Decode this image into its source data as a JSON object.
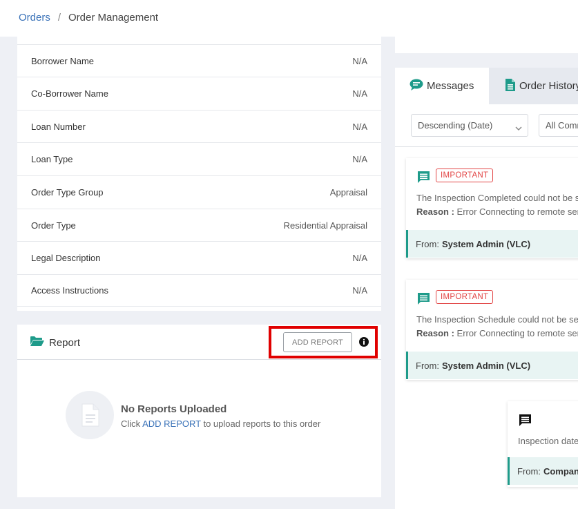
{
  "breadcrumb": {
    "root": "Orders",
    "separator": "/",
    "current": "Order Management"
  },
  "details": [
    {
      "label": "Borrower Name",
      "value": "N/A"
    },
    {
      "label": "Co-Borrower Name",
      "value": "N/A"
    },
    {
      "label": "Loan Number",
      "value": "N/A"
    },
    {
      "label": "Loan Type",
      "value": "N/A"
    },
    {
      "label": "Order Type Group",
      "value": "Appraisal"
    },
    {
      "label": "Order Type",
      "value": "Residential Appraisal"
    },
    {
      "label": "Legal Description",
      "value": "N/A"
    },
    {
      "label": "Access Instructions",
      "value": "N/A"
    }
  ],
  "report": {
    "title": "Report",
    "add_button": "ADD REPORT",
    "empty_title": "No Reports Uploaded",
    "empty_prefix": "Click",
    "empty_link": "ADD REPORT",
    "empty_suffix": "to upload reports to this order"
  },
  "tabs": {
    "messages": "Messages",
    "history": "Order History"
  },
  "filters": {
    "sort": "Descending (Date)",
    "filter": "All Comments"
  },
  "messages": [
    {
      "badge": "IMPORTANT",
      "text": "The Inspection Completed could not be sent",
      "reason_label": "Reason :",
      "reason": "Error Connecting to remote server",
      "from_label": "From:",
      "from": "System Admin (VLC)"
    },
    {
      "badge": "IMPORTANT",
      "text": "The Inspection Schedule could not be sent",
      "reason_label": "Reason :",
      "reason": "Error Connecting to remote server",
      "from_label": "From:",
      "from": "System Admin (VLC)"
    },
    {
      "text": "Inspection date",
      "from_label": "From:",
      "from": "Company"
    }
  ],
  "colors": {
    "accent_teal": "#1e9b8a",
    "link_blue": "#3a72b8",
    "important_red": "#e24444",
    "highlight_red": "#e00000"
  }
}
